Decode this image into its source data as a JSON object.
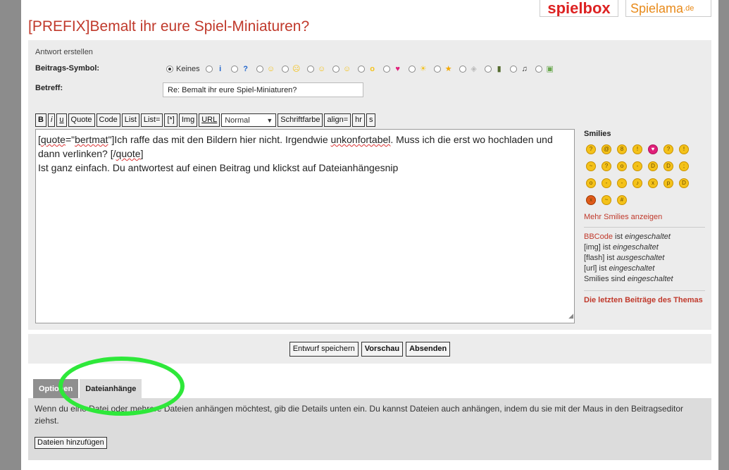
{
  "logos": {
    "spielbox": "spielbox",
    "spielama": "Spielama",
    "spielama_tld": ".de"
  },
  "title": "[PREFIX]Bemalt ihr eure Spiel-Miniaturen?",
  "form": {
    "caption": "Antwort erstellen",
    "post_icon_label": "Beitrags-Symbol:",
    "post_icon_none": "Keines",
    "subject_label": "Betreff:",
    "subject_value": "Re: Bemalt ihr eure Spiel-Miniaturen?"
  },
  "post_icons": [
    {
      "name": "info-icon",
      "glyph": "i",
      "color": "#2266cc"
    },
    {
      "name": "question-icon",
      "glyph": "?",
      "color": "#2266cc"
    },
    {
      "name": "smile-icon",
      "glyph": "☺",
      "color": "#f4c21a"
    },
    {
      "name": "frown-icon",
      "glyph": "☹",
      "color": "#f4c21a"
    },
    {
      "name": "grin-icon",
      "glyph": "☺",
      "color": "#f4c21a"
    },
    {
      "name": "tongue-icon",
      "glyph": "☺",
      "color": "#f4c21a"
    },
    {
      "name": "surprised-icon",
      "glyph": "o",
      "color": "#f4c21a"
    },
    {
      "name": "heart-icon",
      "glyph": "♥",
      "color": "#e0207a"
    },
    {
      "name": "lightbulb-icon",
      "glyph": "☀",
      "color": "#f4c21a"
    },
    {
      "name": "star-icon",
      "glyph": "★",
      "color": "#f4a800"
    },
    {
      "name": "cube-icon",
      "glyph": "◈",
      "color": "#bbbbbb"
    },
    {
      "name": "film-icon",
      "glyph": "▮",
      "color": "#556b2f"
    },
    {
      "name": "music-icon",
      "glyph": "♫",
      "color": "#333333"
    },
    {
      "name": "picture-icon",
      "glyph": "▣",
      "color": "#6aa84f"
    }
  ],
  "toolbar": {
    "b": "B",
    "i": "i",
    "u": "u",
    "quote": "Quote",
    "code": "Code",
    "list": "List",
    "list_eq": "List=",
    "list_item": "[*]",
    "img": "Img",
    "url": "URL",
    "size_select": "Normal",
    "font_color": "Schriftfarbe",
    "align": "align=",
    "hr": "hr",
    "s": "s"
  },
  "editor": {
    "part1": "[",
    "quote_word": "quote",
    "part2": "=\"",
    "author": "bertmat",
    "part3": "\"]Ich raffe das mit den Bildern hier nicht. Irgendwie ",
    "misspelled": "unkonfortabel",
    "part4": ". Muss ich die erst wo hochladen und dann verlinken? [/",
    "quote_close": "quote",
    "part5": "]",
    "line2": "Ist ganz einfach. Du antwortest auf einen Beitrag und klickst auf Dateianhängesnip"
  },
  "sidebar": {
    "smilies_title": "Smilies",
    "more_smilies": "Mehr Smilies anzeigen",
    "bbcode_link": "BBCode",
    "bbcode_rest": " ist ",
    "bbcode_state": "eingeschaltet",
    "img_line": "[img] ist ",
    "img_state": "eingeschaltet",
    "flash_line": "[flash] ist ",
    "flash_state": "ausgeschaltet",
    "url_line": "[url] ist ",
    "url_state": "eingeschaltet",
    "smilies_line": "Smilies sind ",
    "smilies_state": "eingeschaltet",
    "last_posts": "Die letzten Beiträge des Themas"
  },
  "smilies": [
    {
      "name": "confused-smilie-icon",
      "glyph": "?"
    },
    {
      "name": "monkey-smilie-icon",
      "glyph": "@"
    },
    {
      "name": "cool-smilie-icon",
      "glyph": "8"
    },
    {
      "name": "exclaim-smilie-icon",
      "glyph": "!"
    },
    {
      "name": "heart-smilie-icon",
      "glyph": "♥",
      "kind": "heart"
    },
    {
      "name": "question-smilie-icon",
      "glyph": "?"
    },
    {
      "name": "idea-smilie-icon",
      "glyph": "!"
    },
    {
      "name": "sad-smilie-icon",
      "glyph": "~"
    },
    {
      "name": "doubt-smilie-icon",
      "glyph": "?"
    },
    {
      "name": "shock-smilie-icon",
      "glyph": "o"
    },
    {
      "name": "smile-smilie-icon",
      "glyph": "-"
    },
    {
      "name": "grin-smilie-icon",
      "glyph": "D"
    },
    {
      "name": "laugh-smilie-icon",
      "glyph": "D"
    },
    {
      "name": "wink-smilie-icon",
      "glyph": ";"
    },
    {
      "name": "eek-smilie-icon",
      "glyph": "o"
    },
    {
      "name": "happy-smilie-icon",
      "glyph": "-"
    },
    {
      "name": "neutral-smilie-icon",
      "glyph": "-"
    },
    {
      "name": "headphones-smilie-icon",
      "glyph": "♪"
    },
    {
      "name": "pirate-smilie-icon",
      "glyph": "x"
    },
    {
      "name": "tongue-smilie-icon",
      "glyph": "p"
    },
    {
      "name": "big-smile-smilie-icon",
      "glyph": "D"
    },
    {
      "name": "angry-smilie-icon",
      "glyph": "x",
      "kind": "angry"
    },
    {
      "name": "crying-smilie-icon",
      "glyph": "~"
    },
    {
      "name": "mad-smilie-icon",
      "glyph": "#"
    }
  ],
  "actions": {
    "save_draft": "Entwurf speichern",
    "preview": "Vorschau",
    "submit": "Absenden"
  },
  "tabs": {
    "options": "Optionen",
    "attachments": "Dateianhänge"
  },
  "attachments": {
    "description": "Wenn du eine Datei oder mehrere Dateien anhängen möchtest, gib die Details unten ein. Du kannst Dateien auch anhängen, indem du sie mit der Maus in den Beitragseditor ziehst.",
    "add_files": "Dateien hinzufügen"
  },
  "colors": {
    "accent": "#c0392b",
    "highlight": "#2ee83a",
    "panel": "#ececec"
  }
}
